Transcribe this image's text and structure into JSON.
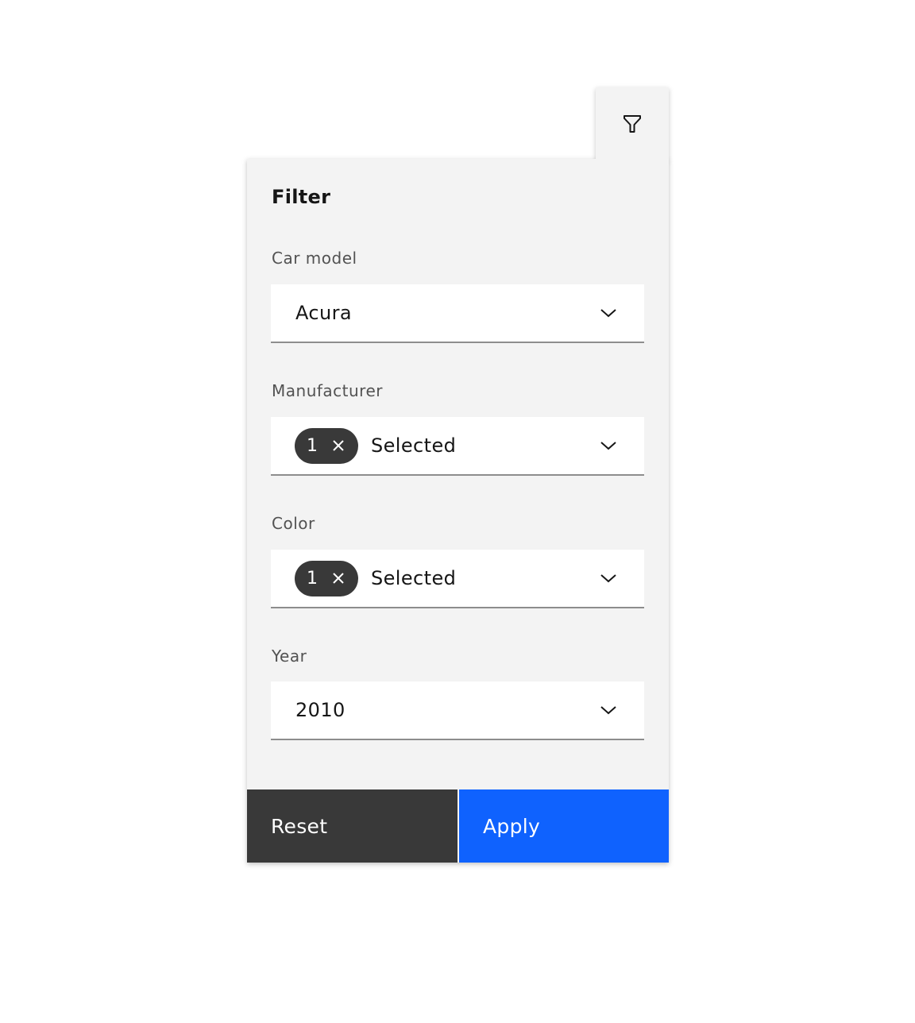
{
  "trigger": {
    "icon": "filter-icon"
  },
  "panel": {
    "title": "Filter",
    "fields": [
      {
        "label": "Car model",
        "value": "Acura",
        "type": "dropdown"
      },
      {
        "label": "Manufacturer",
        "value": "Selected",
        "type": "multiselect",
        "selected_count": "1"
      },
      {
        "label": "Color",
        "value": "Selected",
        "type": "multiselect",
        "selected_count": "1"
      },
      {
        "label": "Year",
        "value": "2010",
        "type": "dropdown"
      }
    ],
    "actions": {
      "reset_label": "Reset",
      "apply_label": "Apply"
    }
  },
  "colors": {
    "primary": "#0f62fe",
    "secondary": "#393939",
    "panel_bg": "#f3f3f3"
  }
}
